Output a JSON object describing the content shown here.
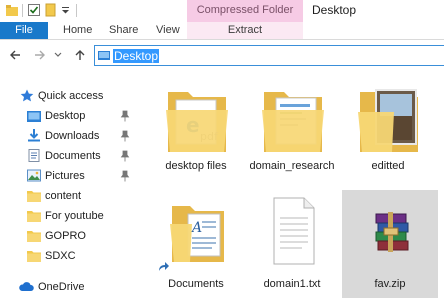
{
  "window": {
    "title": "Desktop",
    "contextual_tab_group": "Compressed Folder Tools"
  },
  "ribbon": {
    "tabs": [
      "File",
      "Home",
      "Share",
      "View",
      "Extract"
    ]
  },
  "address_bar": {
    "path": "Desktop"
  },
  "nav_pane": {
    "quick_access_label": "Quick access",
    "items": [
      {
        "label": "Desktop",
        "icon": "desktop-folder-icon",
        "pinned": true
      },
      {
        "label": "Downloads",
        "icon": "downloads-icon",
        "pinned": true
      },
      {
        "label": "Documents",
        "icon": "documents-icon",
        "pinned": true
      },
      {
        "label": "Pictures",
        "icon": "pictures-icon",
        "pinned": true
      },
      {
        "label": "content",
        "icon": "folder-icon",
        "pinned": false
      },
      {
        "label": "For youtube",
        "icon": "folder-icon",
        "pinned": false
      },
      {
        "label": "GOPRO",
        "icon": "folder-icon",
        "pinned": false
      },
      {
        "label": "SDXC",
        "icon": "folder-icon",
        "pinned": false
      }
    ],
    "onedrive_label": "OneDrive"
  },
  "files": [
    {
      "name": "desktop files",
      "type": "folder",
      "selected": false
    },
    {
      "name": "domain_research",
      "type": "folder",
      "selected": false
    },
    {
      "name": "editted",
      "type": "folder",
      "selected": false
    },
    {
      "name": "Documents",
      "type": "folder-shortcut",
      "selected": false
    },
    {
      "name": "domain1.txt",
      "type": "text-file",
      "selected": false
    },
    {
      "name": "fav.zip",
      "type": "zip-archive",
      "selected": true
    }
  ],
  "colors": {
    "accent": "#1979ca",
    "contextual_tab": "#f6cbe5",
    "selection": "#3399ff",
    "selected_tile": "#d9d9d9",
    "folder": "#f5cf6b"
  }
}
